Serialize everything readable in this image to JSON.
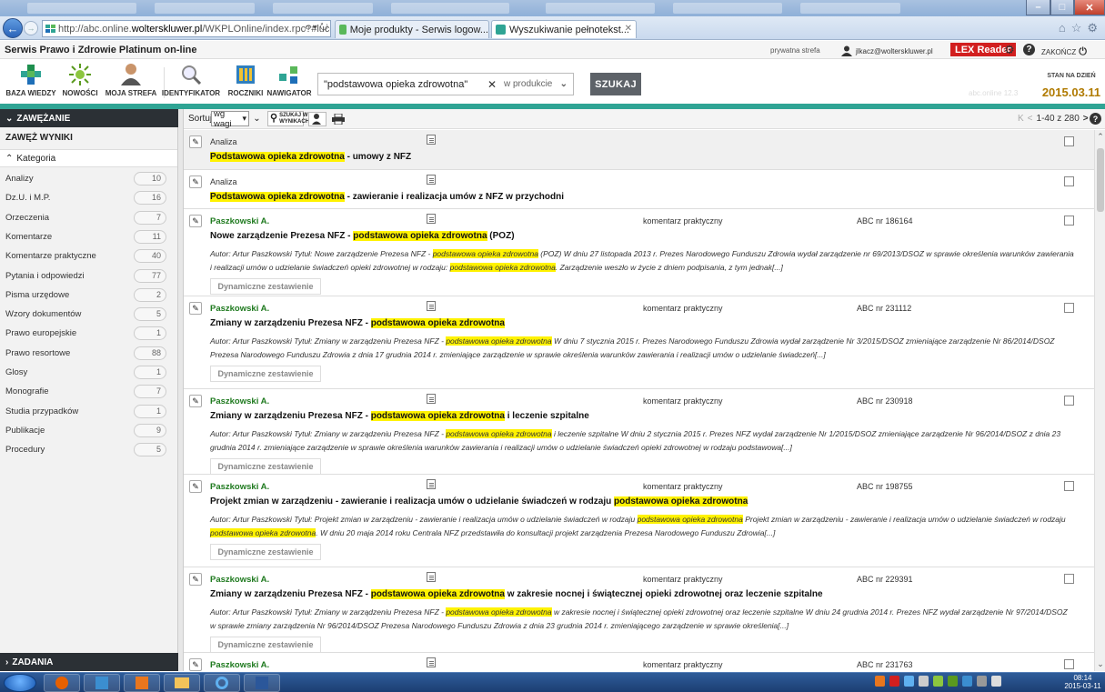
{
  "browser": {
    "url_prefix": "http://abc.online.",
    "url_domain": "wolterskluwer.pl",
    "url_suffix": "/WKPLOnline/index.rpc?#luceneWebcs",
    "url_controls": "⌕ ▾ ↻",
    "tabs": [
      {
        "label": "Moje produkty - Serwis logow..."
      },
      {
        "label": "Wyszukiwanie pełnotekst...",
        "close": "✕"
      }
    ]
  },
  "app": {
    "name": "Serwis Prawo i Zdrowie Platinum on-line",
    "zone": "prywatna strefa",
    "user_email": "jlkacz@wolterskluwer.pl",
    "lex_reader": "LEX Reader",
    "end_label": "ZAKOŃCZ"
  },
  "toolbar": {
    "items": [
      {
        "label": "BAZA WIEDZY"
      },
      {
        "label": "NOWOŚCI"
      },
      {
        "label": "MOJA STREFA"
      },
      {
        "label": "IDENTYFIKATOR"
      },
      {
        "label": "ROCZNIKI"
      },
      {
        "label": "NAWIGATOR"
      }
    ],
    "search_query": "\"podstawowa opieka zdrowotna\"",
    "search_clear": "✕",
    "search_scope": "w produkcie",
    "search_button": "SZUKAJ",
    "stan_label": "STAN NA DZIEŃ",
    "stan_date": "2015.03.11"
  },
  "sidebar": {
    "header": "ZAWĘŻANIE",
    "subheader": "ZAWĘŻ WYNIKI",
    "category_label": "Kategoria",
    "categories": [
      {
        "label": "Analizy",
        "count": "10"
      },
      {
        "label": "Dz.U. i M.P.",
        "count": "16"
      },
      {
        "label": "Orzeczenia",
        "count": "7"
      },
      {
        "label": "Komentarze",
        "count": "11"
      },
      {
        "label": "Komentarze praktyczne",
        "count": "40"
      },
      {
        "label": "Pytania i odpowiedzi",
        "count": "77"
      },
      {
        "label": "Pisma urzędowe",
        "count": "2"
      },
      {
        "label": "Wzory dokumentów",
        "count": "5"
      },
      {
        "label": "Prawo europejskie",
        "count": "1"
      },
      {
        "label": "Prawo resortowe",
        "count": "88"
      },
      {
        "label": "Glosy",
        "count": "1"
      },
      {
        "label": "Monografie",
        "count": "7"
      },
      {
        "label": "Studia przypadków",
        "count": "1"
      },
      {
        "label": "Publikacje",
        "count": "9"
      },
      {
        "label": "Procedury",
        "count": "5"
      }
    ],
    "footer": "ZADANIA"
  },
  "results_bar": {
    "sort_label": "Sortuj",
    "sort_value": "wg wagi",
    "search_in_results": "SZUKAJ W WYNIKACH",
    "pagination": "1-40 z 280"
  },
  "results": [
    {
      "head": "Analiza",
      "title_parts": [
        "",
        "Podstawowa opieka zdrowotna",
        " - umowy z NFZ"
      ]
    },
    {
      "head": "Analiza",
      "title_parts": [
        "",
        "Podstawowa opieka zdrowotna",
        " - zawieranie i realizacja umów z NFZ w przychodni"
      ]
    },
    {
      "head": "Paszkowski A.",
      "kind": "komentarz praktyczny",
      "abc": "ABC nr 186164",
      "title_parts": [
        "Nowe zarządzenie Prezesa NFZ - ",
        "podstawowa opieka zdrowotna",
        " (POZ)"
      ],
      "desc_parts": [
        "Autor: Artur Paszkowski Tytuł: Nowe zarządzenie Prezesa NFZ - ",
        "podstawowa opieka zdrowotna",
        " (POZ) W dniu 27 listopada 2013 r. Prezes Narodowego Funduszu Zdrowia wydał zarządzenie nr 69/2013/DSOZ w sprawie określenia warunków zawierania i realizacji umów o udzielanie świadczeń opieki zdrowotnej w rodzaju: ",
        "podstawowa opieka zdrowotna",
        ". Zarządzenie weszło w życie z dniem podpisania, z tym jednak[...]"
      ],
      "dyn": "Dynamiczne zestawienie"
    },
    {
      "head": "Paszkowski A.",
      "kind": "komentarz praktyczny",
      "abc": "ABC nr 231112",
      "title_parts": [
        "Zmiany w zarządzeniu Prezesa NFZ - ",
        "podstawowa opieka zdrowotna",
        ""
      ],
      "desc_parts": [
        "Autor: Artur Paszkowski Tytuł: Zmiany w zarządzeniu Prezesa NFZ - ",
        "podstawowa opieka zdrowotna",
        " W dniu 7 stycznia 2015 r. Prezes Narodowego Funduszu Zdrowia wydał zarządzenie Nr 3/2015/DSOZ zmieniające zarządzenie Nr 86/2014/DSOZ Prezesa Narodowego Funduszu Zdrowia z dnia 17 grudnia 2014 r. zmieniające zarządzenie w sprawie określenia warunków zawierania i realizacji umów o udzielanie świadczeń[...]"
      ],
      "dyn": "Dynamiczne zestawienie"
    },
    {
      "head": "Paszkowski A.",
      "kind": "komentarz praktyczny",
      "abc": "ABC nr 230918",
      "title_parts": [
        "Zmiany w zarządzeniu Prezesa NFZ - ",
        "podstawowa opieka zdrowotna",
        " i leczenie szpitalne"
      ],
      "desc_parts": [
        "Autor: Artur Paszkowski Tytuł: Zmiany w zarządzeniu Prezesa NFZ - ",
        "podstawowa opieka zdrowotna",
        " i leczenie szpitalne W dniu 2 stycznia 2015 r. Prezes NFZ wydał zarządzenie Nr 1/2015/DSOZ zmieniające zarządzenie Nr 96/2014/DSOZ z dnia 23 grudnia 2014 r. zmieniające zarządzenie w sprawie określenia warunków zawierania i realizacji umów o udzielanie świadczeń opieki zdrowotnej w rodzaju podstawowa[...]"
      ],
      "dyn": "Dynamiczne zestawienie"
    },
    {
      "head": "Paszkowski A.",
      "kind": "komentarz praktyczny",
      "abc": "ABC nr 198755",
      "title_parts": [
        "Projekt zmian w zarządzeniu - zawieranie i realizacja umów o udzielanie świadczeń w rodzaju ",
        "podstawowa opieka zdrowotna",
        ""
      ],
      "desc_parts": [
        "Autor: Artur Paszkowski Tytuł: Projekt zmian w zarządzeniu - zawieranie i realizacja umów o udzielanie świadczeń w rodzaju ",
        "podstawowa opieka zdrowotna",
        " Projekt zmian w zarządzeniu - zawieranie i realizacja umów o udzielanie świadczeń w rodzaju ",
        "podstawowa opieka zdrowotna",
        ". W dniu 20 maja 2014 roku Centrala NFZ przedstawiła do konsultacji projekt zarządzenia Prezesa Narodowego Funduszu Zdrowia[...]"
      ],
      "dyn": "Dynamiczne zestawienie"
    },
    {
      "head": "Paszkowski A.",
      "kind": "komentarz praktyczny",
      "abc": "ABC nr 229391",
      "title_parts": [
        "Zmiany w zarządzeniu Prezesa NFZ - ",
        "podstawowa opieka zdrowotna",
        " w zakresie nocnej i świątecznej opieki zdrowotnej oraz leczenie szpitalne"
      ],
      "desc_parts": [
        "Autor: Artur Paszkowski Tytuł: Zmiany w zarządzeniu Prezesa NFZ - ",
        "podstawowa opieka zdrowotna",
        " w zakresie nocnej i świątecznej opieki zdrowotnej oraz leczenie szpitalne W dniu 24 grudnia 2014 r. Prezes NFZ wydał zarządzenie Nr 97/2014/DSOZ w sprawie zmiany zarządzenia Nr 96/2014/DSOZ Prezesa Narodowego Funduszu Zdrowia z dnia 23 grudnia 2014 r. zmieniającego zarządzenie w sprawie określenia[...]"
      ],
      "dyn": "Dynamiczne zestawienie"
    },
    {
      "head": "Paszkowski A.",
      "kind": "komentarz praktyczny",
      "abc": "ABC nr 231763"
    }
  ],
  "taskbar": {
    "time": "08:14",
    "date": "2015-03-11"
  },
  "colors": {
    "accent_teal": "#2fa494",
    "author_green": "#1f7a1f",
    "highlight": "#fff200",
    "lex_red": "#d21f1f",
    "date_gold": "#b07a00"
  }
}
